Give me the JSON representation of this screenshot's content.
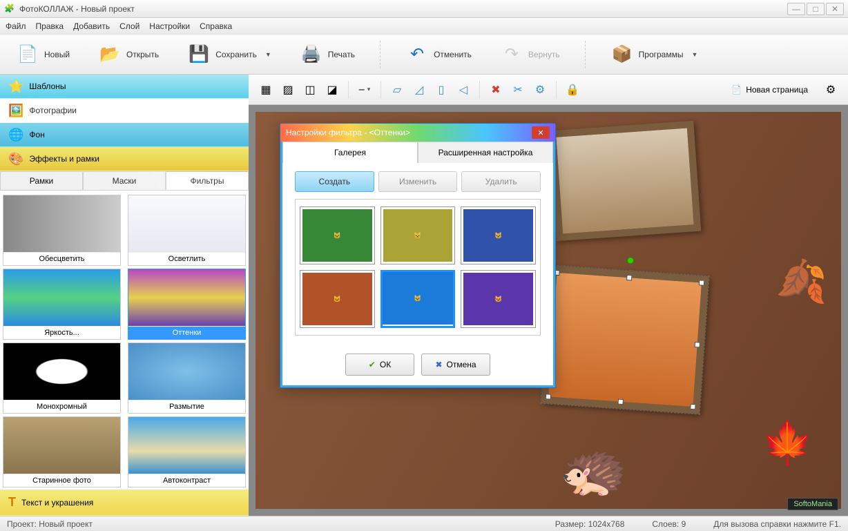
{
  "window": {
    "title": "ФотоКОЛЛАЖ - Новый проект"
  },
  "menu": {
    "file": "Файл",
    "edit": "Правка",
    "add": "Добавить",
    "layer": "Слой",
    "settings": "Настройки",
    "help": "Справка"
  },
  "toolbar": {
    "new": "Новый",
    "open": "Открыть",
    "save": "Сохранить",
    "print": "Печать",
    "undo": "Отменить",
    "redo": "Вернуть",
    "programs": "Программы"
  },
  "side": {
    "templates": "Шаблоны",
    "photos": "Фотографии",
    "background": "Фон",
    "effects": "Эффекты и рамки",
    "text": "Текст и украшения",
    "subtabs": {
      "frames": "Рамки",
      "masks": "Маски",
      "filters": "Фильтры"
    },
    "filters": [
      {
        "name": "Обесцветить",
        "bg": "linear-gradient(90deg,#888,#ccc)"
      },
      {
        "name": "Осветлить",
        "bg": "linear-gradient(#f8f8ff,#e8e8f0)"
      },
      {
        "name": "Яркость...",
        "bg": "linear-gradient(#2a9be8,#57d084 50%,#2a8be0)"
      },
      {
        "name": "Оттенки",
        "bg": "linear-gradient(#b44ac4,#e8d050 50%,#6a40b0)",
        "selected": true
      },
      {
        "name": "Монохромный",
        "bg": "radial-gradient(#fff 30%,#000 32%)"
      },
      {
        "name": "Размытие",
        "bg": "radial-gradient(#7fbfe8,#4a90c8)"
      },
      {
        "name": "Старинное фото",
        "bg": "linear-gradient(#b8a070,#8a7550)"
      },
      {
        "name": "Автоконтраст",
        "bg": "linear-gradient(#4aa8e8,#e8dca8 60%,#3a90d0)"
      }
    ]
  },
  "canvas_toolbar": {
    "icons": [
      "bring-front",
      "send-back",
      "bring-forward",
      "send-backward",
      "align",
      "shear-h",
      "skew",
      "flip-h",
      "flip-v",
      "delete",
      "crop",
      "settings",
      "lock"
    ],
    "new_page": "Новая страница"
  },
  "dialog": {
    "title": "Настройки фильтра - <Оттенки>",
    "tabs": {
      "gallery": "Галерея",
      "advanced": "Расширенная настройка"
    },
    "actions": {
      "create": "Создать",
      "edit": "Изменить",
      "delete": "Удалить"
    },
    "presets": [
      {
        "tint": "#3fa040"
      },
      {
        "tint": "#c8c040"
      },
      {
        "tint": "#3a60c8"
      },
      {
        "tint": "#d06030"
      },
      {
        "tint": "#2090ff",
        "selected": true
      },
      {
        "tint": "#6a40c8"
      }
    ],
    "ok": "ОК",
    "cancel": "Отмена"
  },
  "status": {
    "project": "Проект: Новый проект",
    "size": "Размер: 1024x768",
    "layers": "Слоев: 9",
    "help": "Для вызова справки нажмите F1."
  },
  "badge": "SoftoMania"
}
